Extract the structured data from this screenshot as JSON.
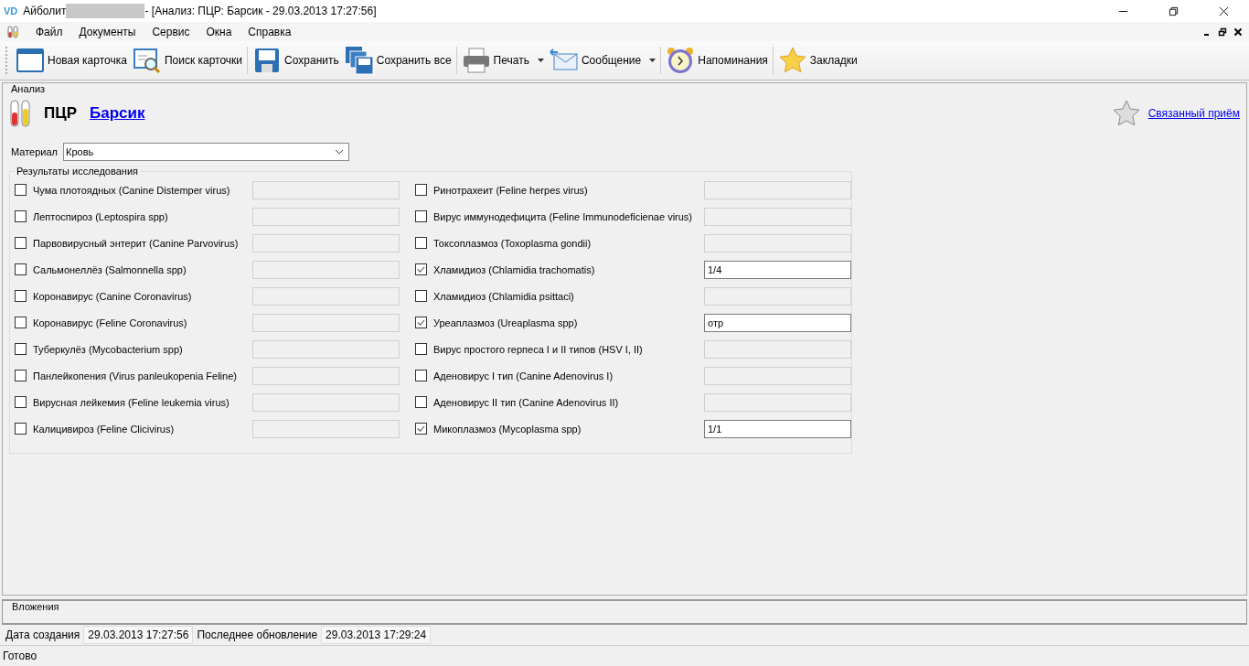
{
  "window": {
    "logo": "VD",
    "app_name": "Айболит",
    "title": "- [Анализ: ПЦР: Барсик - 29.03.2013 17:27:56]"
  },
  "menu": [
    "Файл",
    "Документы",
    "Сервис",
    "Окна",
    "Справка"
  ],
  "toolbar": [
    {
      "label": "Новая карточка",
      "dropdown": false
    },
    {
      "label": "Поиск карточки",
      "dropdown": false
    },
    {
      "label": "Сохранить",
      "dropdown": false
    },
    {
      "label": "Сохранить все",
      "dropdown": false
    },
    {
      "label": "Печать",
      "dropdown": true
    },
    {
      "label": "Сообщение",
      "dropdown": true
    },
    {
      "label": "Напоминания",
      "dropdown": false
    },
    {
      "label": "Закладки",
      "dropdown": false
    }
  ],
  "section": {
    "title": "Анализ",
    "type": "ПЦР",
    "patient": "Барсик",
    "related_link": "Связанный приём"
  },
  "material": {
    "label": "Материал",
    "value": "Кровь"
  },
  "results": {
    "title": "Результаты исследования",
    "columns": [
      [
        {
          "label": "Чума плотоядных (Canine Distemper virus)",
          "checked": false
        },
        {
          "label": "Лептоспироз (Leptospira spp)",
          "checked": false
        },
        {
          "label": "Парвовирусный энтерит (Canine Parvovirus)",
          "checked": false
        },
        {
          "label": "Сальмонеллёз (Salmonnella spp)",
          "checked": false
        },
        {
          "label": "Коронавирус (Canine Coronavirus)",
          "checked": false
        },
        {
          "label": "Коронавирус (Feline Coronavirus)",
          "checked": false
        },
        {
          "label": "Туберкулёз (Mycobacterium spp)",
          "checked": false
        },
        {
          "label": "Панлейкопения (Virus panleukopenia Feline)",
          "checked": false
        },
        {
          "label": "Вирусная лейкемия (Feline leukemia virus)",
          "checked": false
        },
        {
          "label": "Калицивироз (Feline Clicivirus)",
          "checked": false
        }
      ],
      [
        {
          "label": "Ринотрахеит (Feline herpes virus)",
          "checked": false
        },
        {
          "label": "Вирус иммунодефицита (Feline Immunodeficienae virus)",
          "checked": false
        },
        {
          "label": "Токсоплазмоз (Toxoplasma gondii)",
          "checked": false
        },
        {
          "label": "Хламидиоз (Chlamidia trachomatis)",
          "checked": true,
          "value": "1/4"
        },
        {
          "label": "Хламидиоз (Chlamidia psittaci)",
          "checked": false
        },
        {
          "label": "Уреаплазмоз (Ureaplasma spp)",
          "checked": true,
          "value": "отр"
        },
        {
          "label": "Вирус простого герпеса I и II типов (HSV I, II)",
          "checked": false
        },
        {
          "label": "Аденовирус I тип (Canine Adenovirus I)",
          "checked": false
        },
        {
          "label": "Аденовирус II тип (Canine Adenovirus II)",
          "checked": false
        },
        {
          "label": "Микоплазмоз (Mycoplasma spp)",
          "checked": true,
          "value": "1/1"
        }
      ]
    ]
  },
  "attachments": {
    "title": "Вложения"
  },
  "dates": {
    "created_label": "Дата создания",
    "created": "29.03.2013 17:27:56",
    "updated_label": "Последнее обновление",
    "updated": "29.03.2013 17:29:24"
  },
  "status_bar": "Готово"
}
